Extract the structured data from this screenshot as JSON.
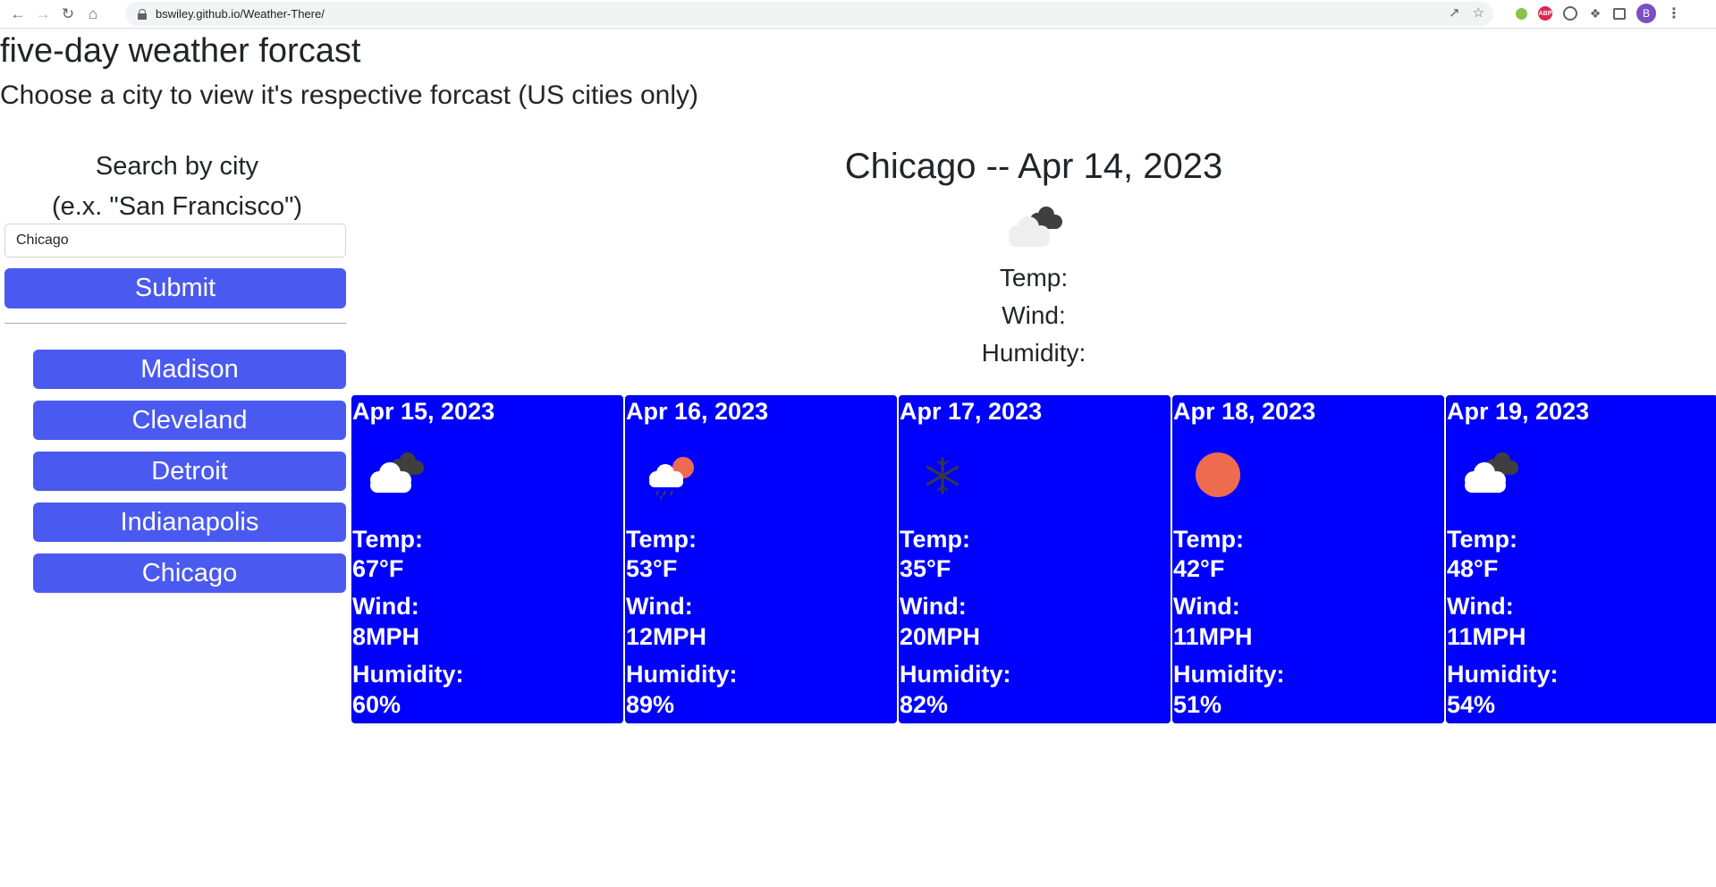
{
  "browser": {
    "url": "bswiley.github.io/Weather-There/",
    "profile_initial": "B",
    "abp_label": "ABP"
  },
  "page": {
    "title": "five-day weather forcast",
    "subtitle": "Choose a city to view it's respective forcast (US cities only)"
  },
  "search": {
    "label_line1": "Search by city",
    "label_line2": "(e.x. \"San Francisco\")",
    "value": "Chicago",
    "submit_label": "Submit"
  },
  "history": [
    "Madison",
    "Cleveland",
    "Detroit",
    "Indianapolis",
    "Chicago"
  ],
  "current": {
    "title": "Chicago -- Apr 14, 2023",
    "icon": "broken-clouds-icon",
    "temp_label": "Temp:",
    "wind_label": "Wind:",
    "humidity_label": "Humidity:"
  },
  "labels": {
    "temp": "Temp:",
    "wind": "Wind:",
    "humidity": "Humidity:"
  },
  "forecast": [
    {
      "date": "Apr 15, 2023",
      "icon": "broken-clouds-icon",
      "temp": "67°F",
      "wind": "8MPH",
      "humidity": "60%"
    },
    {
      "date": "Apr 16, 2023",
      "icon": "rain-icon",
      "temp": "53°F",
      "wind": "12MPH",
      "humidity": "89%"
    },
    {
      "date": "Apr 17, 2023",
      "icon": "snow-icon",
      "temp": "35°F",
      "wind": "20MPH",
      "humidity": "82%"
    },
    {
      "date": "Apr 18, 2023",
      "icon": "clear-sky-icon",
      "temp": "42°F",
      "wind": "11MPH",
      "humidity": "51%"
    },
    {
      "date": "Apr 19, 2023",
      "icon": "broken-clouds-icon",
      "temp": "48°F",
      "wind": "11MPH",
      "humidity": "54%"
    }
  ],
  "colors": {
    "button": "#4a5af0",
    "card": "#0000ff",
    "sun": "#ef6b4f"
  }
}
